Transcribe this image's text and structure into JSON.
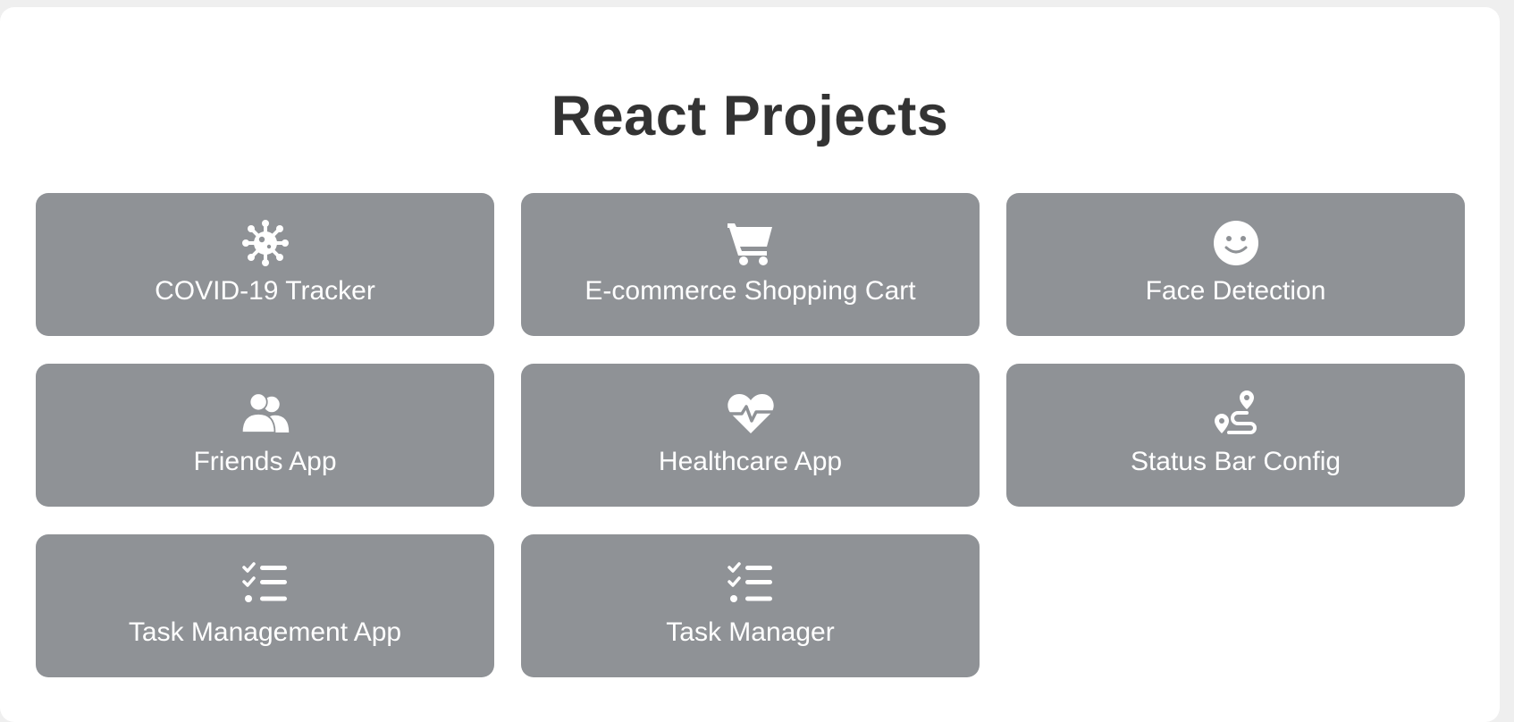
{
  "page": {
    "title": "React Projects"
  },
  "colors": {
    "background": "#efefef",
    "panel": "#ffffff",
    "tile": "#8f9296",
    "title_text": "#333333",
    "tile_text": "#ffffff"
  },
  "projects": [
    {
      "label": "COVID-19 Tracker",
      "icon": "virus-icon"
    },
    {
      "label": "E-commerce Shopping Cart",
      "icon": "shopping-cart-icon"
    },
    {
      "label": "Face Detection",
      "icon": "smiley-face-icon"
    },
    {
      "label": "Friends App",
      "icon": "users-icon"
    },
    {
      "label": "Healthcare App",
      "icon": "heart-pulse-icon"
    },
    {
      "label": "Status Bar Config",
      "icon": "route-icon"
    },
    {
      "label": "Task Management App",
      "icon": "list-check-icon"
    },
    {
      "label": "Task Manager",
      "icon": "list-check-icon"
    }
  ]
}
